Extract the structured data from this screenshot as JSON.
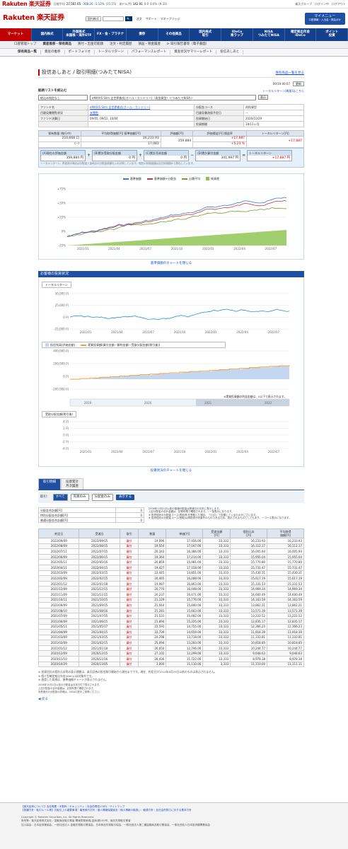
{
  "topbar": {
    "logo": "Rakuten 楽天証券",
    "tickers": [
      {
        "name": "日経平均",
        "value": "27,567.65",
        "chg": "-308.26",
        "pct": "-1.12%",
        "time": "(15:15)",
        "dir": "dn"
      },
      {
        "name": "米ドル/円",
        "value": "142.91",
        "chg": "0.0",
        "pct": "0.0%",
        "time": "(9:31)",
        "dir": "up"
      }
    ],
    "search_type": "国内株式",
    "search_placeholder": "",
    "search_button": "検索",
    "links": [
      "注文",
      "サポート",
      "マネーブリッジ"
    ],
    "right": [
      "楽天グループ",
      "ログイン中",
      "ログアウト"
    ]
  },
  "mypage": {
    "label": "マイメニュー",
    "sub": "口座情報・入出金・照会ほか"
  },
  "gnav": [
    "マーケット",
    "国内株式",
    "外国株式\n米国株・海外ETF",
    "FX・金・プラチナ",
    "債券",
    "その他商品",
    "国内株式\n取引",
    "iDeCo\n楽ラップ",
    "NISA\nつみたてNISA",
    "確定拠出年金\niDeCo",
    "ポイント\n投資"
  ],
  "gnav_active": 0,
  "snav": [
    "口座管理トップ",
    "資産推移・保有商品",
    "買付・出金可能額",
    "注文・約定履歴",
    "損益・税金履歴",
    "⊳ 取引報告書等（電子書面）"
  ],
  "snav_active": 1,
  "tnav": [
    "保有商品一覧",
    "資産の推移",
    "ポートフォリオ",
    "トータルリターン",
    "パフォーマンスレポート",
    "資産状況サマリーレポート",
    "投信あしあと"
  ],
  "tnav_active": 0,
  "title": "投信あしあと / 取引明細(つみたてNISA)",
  "title_link": "保有商品一覧を見る",
  "updated": "09/19 00:07",
  "update_btn": "更新",
  "select_label": "銘柄リストを絞込む",
  "select_link": "トータルリターン(概要)はこちら",
  "select_filter": "絞込み指定なし",
  "select_fund": "eMAXIS Slim 全世界株式(オール・カントリー)〈再投資型〉＜つみたてNISA＞",
  "select_go": "表示",
  "info": {
    "fund_name_label": "ファンド名",
    "fund_name": "eMAXIS Slim 全世界株式(オール・カントリー)",
    "dist_course_label": "分配金コース",
    "dist_course": "再投資型",
    "report_label": "目論見書閲覧状況",
    "report": "未閲覧",
    "report_date_label": "目論見書改版予定日",
    "report_date": "－",
    "settle_label": "ファンド決算日",
    "settle": "09/05, 09/12, 10/04",
    "start_label": "投資開始日",
    "start": "2020/10/29",
    "period_label": "投資期間",
    "period": "1年11ヶ月"
  },
  "position": {
    "headers": [
      "保有数量\n(執行中)",
      "平均取得価額[円]\n基準価額[円]",
      "評価額[円]",
      "評価損益[円]\n損益率",
      "トータルリターン[円]"
    ],
    "qty": "210,668 口",
    "qty2": "(--)",
    "avg": "16,233.93",
    "nav": "17,083",
    "value": "359,884",
    "pl": "+17,887",
    "pl_pct": "+5.23 %",
    "tr": "+17,887"
  },
  "calc": {
    "a_label": "(A)現在の評価金額",
    "a": "359,884 円",
    "b_label": "(B)累計受取分配金額",
    "b": "0 円",
    "c_label": "(C)累計売却金額",
    "c": "0 円",
    "d_label": "(D)累計買付金額",
    "d": "341,997 円",
    "e_label": "トータルリターン",
    "e": "+17,887 円",
    "note": "トータルリターン、再投資の場合は分配金入金時点の分配金総額を入れ計算しています。現在の評価金額は当日評価額から算出しています。"
  },
  "chart1": {
    "legend": [
      "基準価額",
      "基準価額+分配金",
      "分類平均",
      "純資産"
    ],
    "colors": [
      "#3a78d8",
      "#c43c3c",
      "#7a9a2a",
      "#8bc34a"
    ],
    "yticks": [
      "+75%",
      "+50%",
      "+25%",
      "0%",
      "-25%"
    ],
    "xticks": [
      "2021/01",
      "2021/04",
      "2021/07",
      "2021/10",
      "2022/01",
      "2022/04",
      "2022/07"
    ],
    "toggle": "基準価額のチャートを閉じる"
  },
  "section2_title": "お客様の投資状況",
  "chart2": {
    "legend1": "トータルリターン",
    "yticks1": [
      "50,000 円",
      "25,000 円",
      "0 円",
      "-25,000 円"
    ],
    "xticks": [
      "2021/01",
      "2021/04",
      "2021/07",
      "2021/10",
      "2022/01",
      "2022/04",
      "2022/07"
    ],
    "legend2a": "投信残高(評価金額)",
    "legend2b": "実質投資額(買付金額－解約金額－受取分配金額(税引後))",
    "yticks2": [
      "400,000 円",
      "200,000 円",
      "0 円",
      "-200,000 円"
    ],
    "note2": "※実質投資額の利益金額は、0以下で表示されます。",
    "navtick": [
      "2019",
      "2020",
      "2021",
      "2022"
    ],
    "legend3": "受取分配金額(税引後)",
    "yticks3": [
      "4 円",
      "2 円",
      "0 円",
      "-2 円",
      "-4 円"
    ],
    "toggle": "投資状況のチャートを閉じる"
  },
  "tabs": [
    "取引明細",
    "投資累計\n月次履歴"
  ],
  "filter": {
    "label": "取引：",
    "options": [
      "すべて",
      "売買のみ",
      "分配金のみ"
    ],
    "active": 0,
    "show": "表示する"
  },
  "summary": {
    "rows": [
      [
        "分配金合計額[円]",
        "0"
      ],
      [
        "特別分配金合計額[円]",
        "0"
      ],
      [
        "普通分配金合計額[円]",
        "0"
      ]
    ],
    "notes": [
      "2006年10月1日以前の普通分配金は受渡日の月末に表示します。",
      "上記分配金の合計金額は、記録年間で確認されます。\\ 一括表示になります。",
      "※ 投資信託の分配金コース(再投資)を受取した場合、「(1)口」で記載しているものがございます。",
      "※ 投資信託の分配金コース(受取)は再投資が対象外のものであるため、表示されるものとしてもあり、一コース表示になります。"
    ]
  },
  "tx": {
    "headers": [
      "約定日",
      "受渡日",
      "取引",
      "数量",
      "単価[円]",
      "受渡金額\n[円]",
      "個別元本\n[円]",
      "平均取得\n価額[円]"
    ],
    "rows": [
      [
        "2022/09/09",
        "2022/09/15",
        "買付",
        "19,096",
        "17,456.00",
        "33,333",
        "16,233.93",
        "16,233.93"
      ],
      [
        "2022/08/09",
        "2022/08/15",
        "買付",
        "19,554",
        "17,047.00",
        "33,333",
        "16,112.17",
        "16,112.17"
      ],
      [
        "2022/07/11",
        "2022/07/15",
        "買付",
        "20,343",
        "16,386.00",
        "33,333",
        "16,005.94",
        "16,005.94"
      ],
      [
        "2022/06/09",
        "2022/06/15",
        "買付",
        "19,364",
        "17,214.00",
        "33,333",
        "15,955.04",
        "15,955.04"
      ],
      [
        "2022/05/11",
        "2022/05/16",
        "買付",
        "20,859",
        "15,981.00",
        "33,333",
        "15,770.80",
        "15,770.80"
      ],
      [
        "2022/04/11",
        "2022/04/15",
        "買付",
        "19,427",
        "17,158.00",
        "33,333",
        "15,731.47",
        "15,731.47"
      ],
      [
        "2022/03/09",
        "2022/03/15",
        "買付",
        "22,445",
        "14,851.00",
        "33,333",
        "15,430.31",
        "15,430.31"
      ],
      [
        "2022/02/09",
        "2022/02/15",
        "買付",
        "20,465",
        "16,288.00",
        "33,333",
        "15,617.19",
        "15,617.19"
      ],
      [
        "2022/01/12",
        "2022/01/18",
        "買付",
        "19,987",
        "16,863.00",
        "33,333",
        "15,331.53",
        "15,331.53"
      ],
      [
        "2021/12/09",
        "2021/12/15",
        "買付",
        "20,770",
        "16,048.00",
        "33,333",
        "14,969.34",
        "14,969.34"
      ],
      [
        "2021/11/09",
        "2021/11/15",
        "買付",
        "20,237",
        "16,471.00",
        "33,333",
        "14,600.49",
        "14,600.49"
      ],
      [
        "2021/10/11",
        "2021/10/15",
        "買付",
        "21,129",
        "15,776.00",
        "33,333",
        "14,163.59",
        "14,163.59"
      ],
      [
        "2021/09/09",
        "2021/09/15",
        "買付",
        "21,044",
        "15,840.00",
        "33,333",
        "13,862.21",
        "13,862.21"
      ],
      [
        "2021/08/10",
        "2021/08/16",
        "買付",
        "21,281",
        "15,663.00",
        "33,333",
        "13,571.39",
        "13,571.39"
      ],
      [
        "2021/07/09",
        "2021/07/15",
        "買付",
        "21,531",
        "15,482.00",
        "33,333",
        "13,222.52",
        "13,222.52"
      ],
      [
        "2021/06/09",
        "2021/06/15",
        "買付",
        "21,894",
        "15,225.00",
        "33,333",
        "12,835.17",
        "12,835.17"
      ],
      [
        "2021/05/11",
        "2021/05/17",
        "買付",
        "22,591",
        "14,755.00",
        "33,333",
        "12,366.23",
        "12,366.23"
      ],
      [
        "2021/04/09",
        "2021/04/15",
        "買付",
        "22,739",
        "14,659.00",
        "33,333",
        "11,918.39",
        "11,918.39"
      ],
      [
        "2021/03/09",
        "2021/03/15",
        "買付",
        "24,298",
        "13,718.00",
        "33,333",
        "11,333.81",
        "11,333.81"
      ],
      [
        "2021/02/09",
        "2021/02/15",
        "買付",
        "25,094",
        "13,283.00",
        "33,333",
        "10,818.85",
        "10,818.85"
      ],
      [
        "2021/01/12",
        "2021/01/18",
        "買付",
        "26,050",
        "12,796.00",
        "33,333",
        "10,244.77",
        "10,244.77"
      ],
      [
        "2020/12/09",
        "2020/12/15",
        "買付",
        "27,102",
        "12,299.00",
        "33,333",
        "9,648.63",
        "9,648.63"
      ],
      [
        "2020/11/10",
        "2020/11/16",
        "買付",
        "28,436",
        "11,722.00",
        "33,333",
        "8,978.38",
        "8,978.38"
      ],
      [
        "2020/10/29",
        "2020/11/05",
        "買付",
        "3,000",
        "11,110.00",
        "3,333",
        "11,110.00",
        "11,111.11"
      ]
    ]
  },
  "foot_notes": [
    "※ 投資信託の個別元本等の表示期間は、楽天証券の投信取引開始から現在までです。現在、約定日が2014年8月29日以前のものは表示されません。",
    "※ 個人型確定拠出年金(iDeCo)は対象外です。",
    "※ 償還した銘柄は、基準価額チャートが表示されません。"
  ],
  "foot_sub": [
    "2006年10月1日以前の分配金は月末日付で表示されます。",
    "上記分配金の合計金額は、記録年間で確認されます。",
    "未受渡分の分配金の詳細は、NISA口座をご参照ください。"
  ],
  "back": "戻る",
  "footer": {
    "lines": [
      "【楽天証券について】会社概要｜手数料｜セキュリティ｜社会的責任(CSR)｜サイトマップ",
      "【各種方針・取引ルール等】お取引上の重要事項｜最良執行方針｜個人情報保護宣言｜個人情報の取扱い｜勧誘方針｜反社会的勢力に対する基本方針",
      "Copyright © Rakuten Securities, Inc. All Rights Reserved.",
      "商号等：楽天証券株式会社／金融商品取引業者 関東財務局長(金商)第195号、商品先物取引業者",
      "加入協会：日本証券業協会、一般社団法人 金融先物取引業協会、日本商品先物取引協会、一般社団法人第二種金融商品取引業協会、一般社団法人日本投資顧問業協会"
    ]
  }
}
